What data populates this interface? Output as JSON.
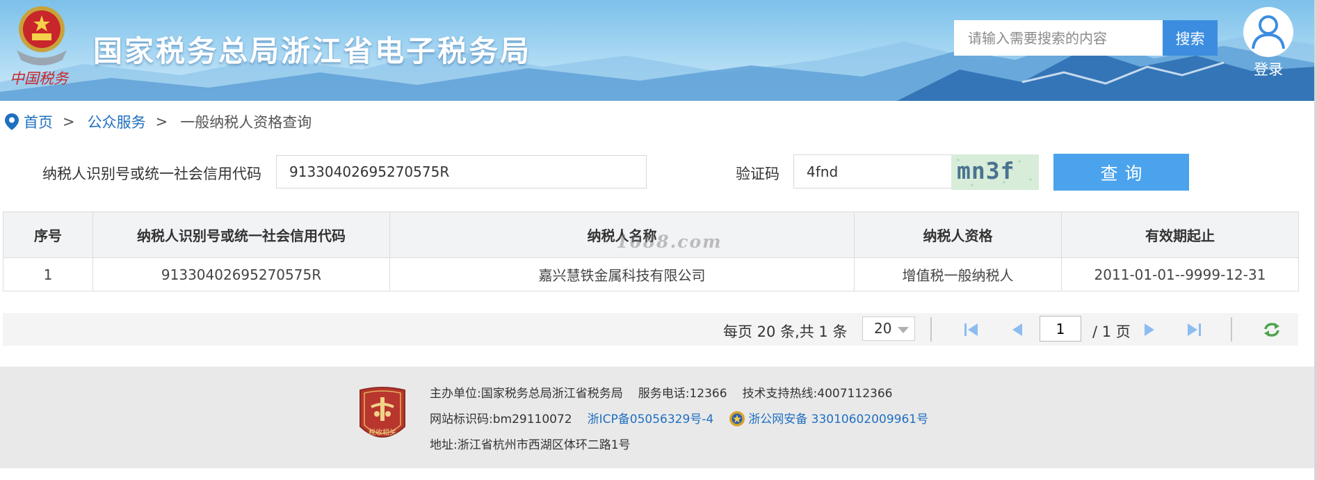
{
  "header": {
    "site_title": "国家税务总局浙江省电子税务局",
    "emblem_motto": "中国税务",
    "search_placeholder": "请输入需要搜索的内容",
    "search_button": "搜索",
    "login_label": "登录"
  },
  "breadcrumb": {
    "home": "首页",
    "sep1": ">",
    "section": "公众服务",
    "sep2": ">",
    "current": "一般纳税人资格查询"
  },
  "form": {
    "tax_id_label": "纳税人识别号或统一社会信用代码",
    "tax_id_value": "91330402695270575R",
    "captcha_label": "验证码",
    "captcha_value": "4fnd",
    "captcha_image_text": "mn3f",
    "query_button": "查询"
  },
  "table": {
    "headers": [
      "序号",
      "纳税人识别号或统一社会信用代码",
      "纳税人名称",
      "纳税人资格",
      "有效期起止"
    ],
    "rows": [
      [
        "1",
        "91330402695270575R",
        "嘉兴慧铁金属科技有限公司",
        "增值税一般纳税人",
        "2011-01-01--9999-12-31"
      ]
    ],
    "watermark": "1688.com"
  },
  "pager": {
    "summary": "每页 20 条,共 1 条",
    "page_size": "20",
    "current_page": "1",
    "total_pages": "/ 1 页"
  },
  "footer": {
    "badge_text": "税收相关",
    "host_label": "主办单位:",
    "host_value": "国家税务总局浙江省税务局",
    "phone_label": "服务电话:",
    "phone_value": "12366",
    "support_label": "技术支持热线:",
    "support_value": "4007112366",
    "site_id_label": "网站标识码:",
    "site_id_value": "bm29110072",
    "icp": "浙ICP备05056329号-4",
    "police_record": "浙公网安备 33010602009961号",
    "address_label": "地址:",
    "address_value": "浙江省杭州市西湖区体环二路1号"
  },
  "colors": {
    "header_sky": "#7cc0ea",
    "search_button": "#3c8de0",
    "query_button": "#4aa3ec",
    "link": "#1f6fc1",
    "table_header_bg": "#f2f3f5",
    "footer_bg": "#e9e9e9",
    "pager_icon": "#5ea2e6",
    "refresh_icon": "#4ea34a",
    "badge": "#b8362e"
  },
  "icons": {
    "breadcrumb": "location-pin-icon",
    "login": "user-avatar-icon",
    "pager_first": "first-page-icon",
    "pager_prev": "prev-page-icon",
    "pager_next": "next-page-icon",
    "pager_last": "last-page-icon",
    "pager_refresh": "refresh-icon",
    "police": "police-badge-icon"
  }
}
